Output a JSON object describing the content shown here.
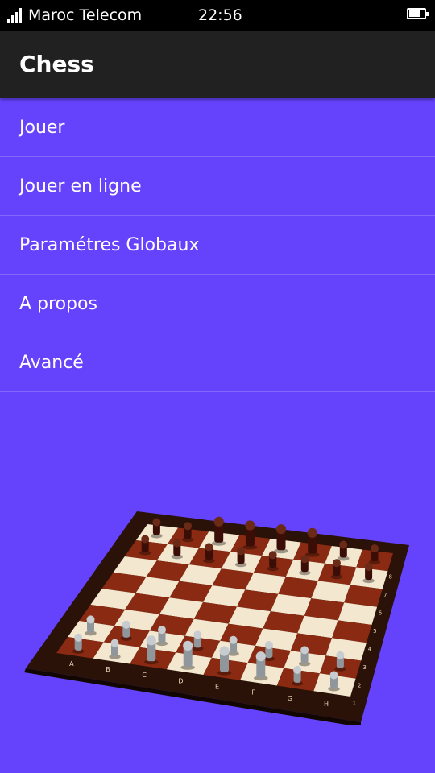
{
  "status_bar": {
    "carrier": "Maroc Telecom",
    "time": "22:56",
    "battery_level": 0.7
  },
  "app_bar": {
    "title": "Chess"
  },
  "menu": {
    "items": [
      {
        "label": "Jouer"
      },
      {
        "label": "Jouer en ligne"
      },
      {
        "label": "Paramétres Globaux"
      },
      {
        "label": "A propos"
      },
      {
        "label": "Avancé"
      }
    ]
  },
  "board": {
    "file_labels": [
      "A",
      "B",
      "C",
      "D",
      "E",
      "F",
      "G",
      "H"
    ],
    "rank_labels": [
      "1",
      "2",
      "3",
      "4",
      "5",
      "6",
      "7",
      "8"
    ]
  },
  "colors": {
    "background": "#6543fc",
    "app_bar": "#212121",
    "status_bar": "#000000",
    "board_dark": "#8a2a12",
    "board_light": "#f3e7cf",
    "frame": "#2a1208"
  }
}
